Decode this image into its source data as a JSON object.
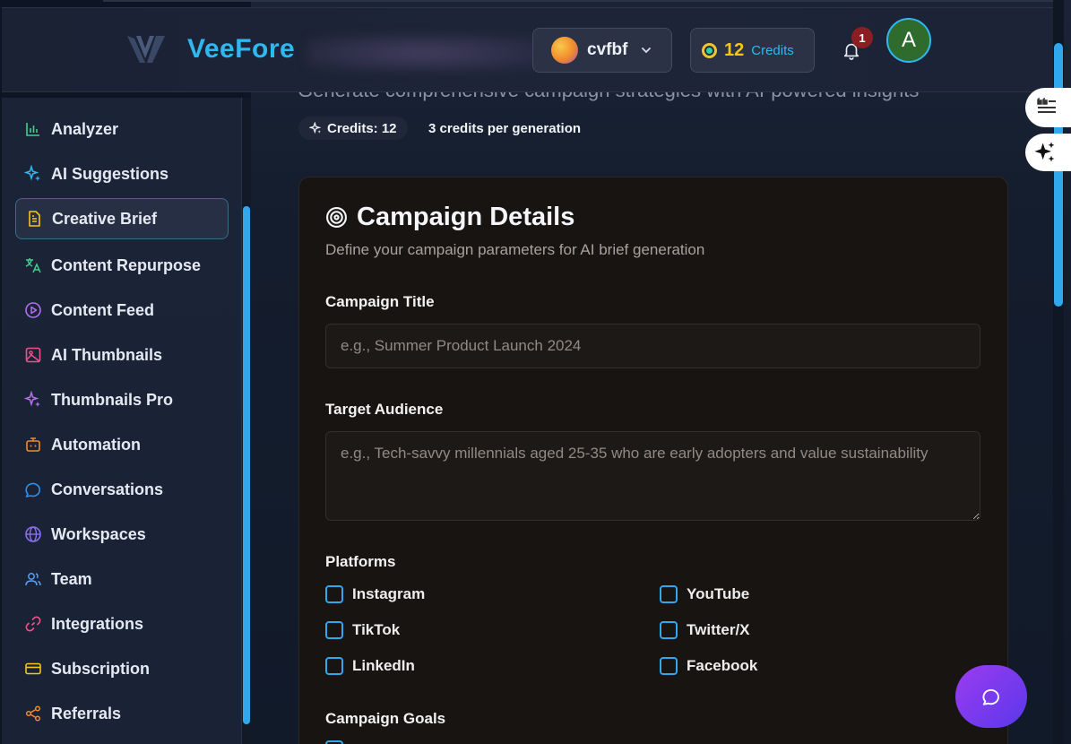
{
  "app": {
    "logo_text": "VeeFore",
    "workspace_name": "cvfbf",
    "credits_count": "12",
    "credits_label": "Credits",
    "notification_count": "1",
    "avatar_initial": "A"
  },
  "sidebar": {
    "items": [
      {
        "label": "Analyzer",
        "icon": "bar-chart-icon",
        "color": "#3fcf8e"
      },
      {
        "label": "AI Suggestions",
        "icon": "sparkles-icon",
        "color": "#2fb8f0"
      },
      {
        "label": "Creative Brief",
        "icon": "document-icon",
        "color": "#f5c518",
        "active": true
      },
      {
        "label": "Content Repurpose",
        "icon": "translate-icon",
        "color": "#3fcf8e"
      },
      {
        "label": "Content Feed",
        "icon": "play-circle-icon",
        "color": "#b070f0"
      },
      {
        "label": "AI Thumbnails",
        "icon": "image-icon",
        "color": "#f0508a"
      },
      {
        "label": "Thumbnails Pro",
        "icon": "sparkles-icon",
        "color": "#b070f0"
      },
      {
        "label": "Automation",
        "icon": "bot-icon",
        "color": "#f08a2c"
      },
      {
        "label": "Conversations",
        "icon": "chat-bubble-icon",
        "color": "#2f90f0"
      },
      {
        "label": "Workspaces",
        "icon": "globe-icon",
        "color": "#8a70f0"
      },
      {
        "label": "Team",
        "icon": "users-icon",
        "color": "#5aa0f0"
      },
      {
        "label": "Integrations",
        "icon": "link-icon",
        "color": "#f0508a"
      },
      {
        "label": "Subscription",
        "icon": "credit-card-icon",
        "color": "#f5c518"
      },
      {
        "label": "Referrals",
        "icon": "share-icon",
        "color": "#f08a2c"
      }
    ]
  },
  "page": {
    "subtitle": "Generate comprehensive campaign strategies with AI-powered insights",
    "credits_pill": "Credits: 12",
    "credits_per_generation": "3 credits per generation"
  },
  "form": {
    "title": "Campaign Details",
    "description": "Define your campaign parameters for AI brief generation",
    "campaign_title_label": "Campaign Title",
    "campaign_title_placeholder": "e.g., Summer Product Launch 2024",
    "target_audience_label": "Target Audience",
    "target_audience_placeholder": "e.g., Tech-savvy millennials aged 25-35 who are early adopters and value sustainability",
    "platforms_label": "Platforms",
    "platforms": [
      "Instagram",
      "YouTube",
      "TikTok",
      "Twitter/X",
      "LinkedIn",
      "Facebook"
    ],
    "goals_label": "Campaign Goals"
  }
}
